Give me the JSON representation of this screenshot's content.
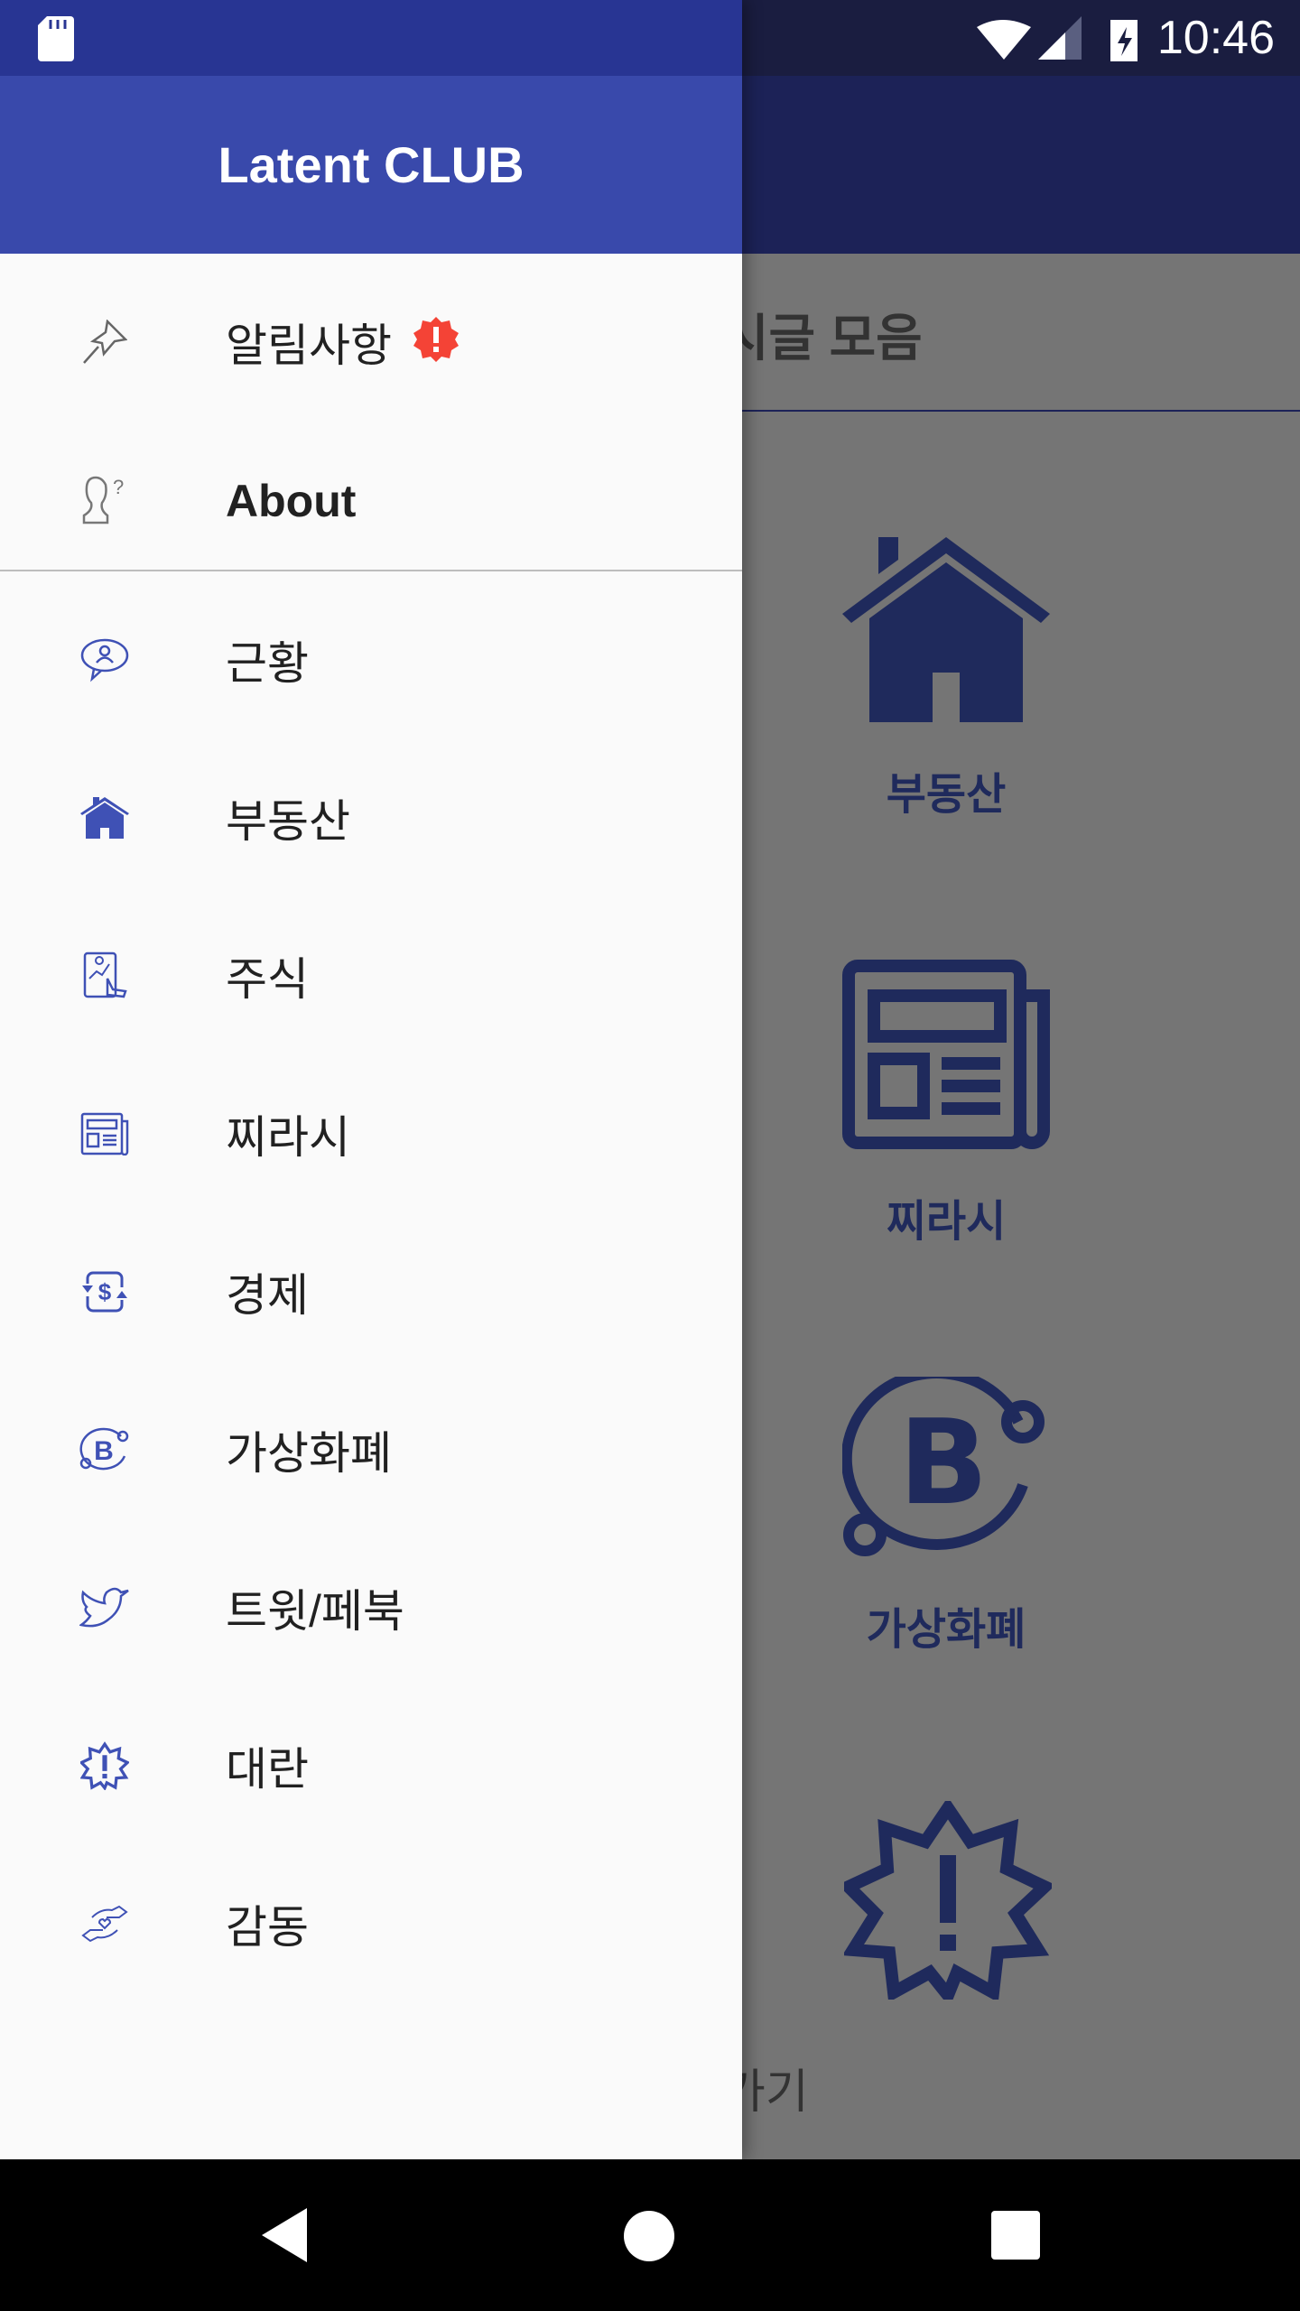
{
  "status_bar": {
    "time": "10:46",
    "icons": [
      "sd-card-icon",
      "wifi-icon",
      "signal-icon",
      "battery-charging-icon"
    ]
  },
  "colors": {
    "drawer_header": "#3949AB",
    "icon": "#3F51B5",
    "badge": "#F44336",
    "toolbar": "#1C2257"
  },
  "drawer": {
    "title": "Latent CLUB",
    "top_items": [
      {
        "label": "알림사항",
        "icon": "pin-icon",
        "badge": "alert-badge-icon"
      },
      {
        "label": "About",
        "icon": "person-question-icon"
      }
    ],
    "items": [
      {
        "label": "근황",
        "icon": "chat-person-icon"
      },
      {
        "label": "부동산",
        "icon": "house-icon"
      },
      {
        "label": "주식",
        "icon": "stock-tablet-icon"
      },
      {
        "label": "찌라시",
        "icon": "newspaper-icon"
      },
      {
        "label": "경제",
        "icon": "dollar-exchange-icon"
      },
      {
        "label": "가상화폐",
        "icon": "bitcoin-icon"
      },
      {
        "label": "트윗/페북",
        "icon": "twitter-icon"
      },
      {
        "label": "대란",
        "icon": "alert-burst-icon"
      },
      {
        "label": "감동",
        "icon": "hands-heart-icon"
      }
    ]
  },
  "background": {
    "title": "시글 모음",
    "categories": [
      {
        "label": "부동산"
      },
      {
        "label": "찌라시"
      },
      {
        "label": "가상화폐"
      }
    ],
    "bottom_text": "가기"
  },
  "nav_bar": {
    "buttons": [
      "back-icon",
      "home-icon",
      "recents-icon"
    ]
  }
}
